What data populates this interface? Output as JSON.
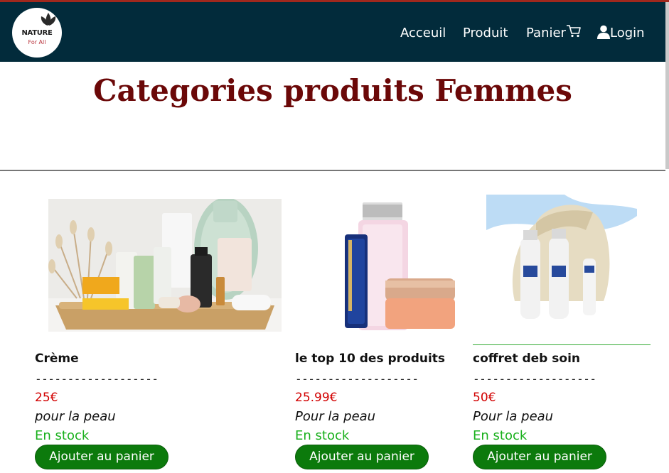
{
  "brand": {
    "logo_word": "NATURE",
    "logo_sub": "For All"
  },
  "nav": {
    "accueil": "Acceuil",
    "produit": "Produit",
    "panier": "Panier",
    "login": "Login"
  },
  "page": {
    "title": "Categories produits Femmes"
  },
  "colors": {
    "navbar": "#022b3b",
    "accent_bar": "#a0281d",
    "title": "#6b0808",
    "price": "#d20000",
    "stock": "#19b01c",
    "button": "#0c7a0c"
  },
  "products": [
    {
      "name": "Crème",
      "separator": "-------------------",
      "price": "25€",
      "description": "pour la peau",
      "stock": "En stock",
      "button": "Ajouter au panier",
      "image": "skincare-tray-photo"
    },
    {
      "name": "le top 10 des produits",
      "separator": "-------------------",
      "price": "25.99€",
      "description": "Pour la peau",
      "stock": "En stock",
      "button": "Ajouter au panier",
      "image": "lancome-clarins-products-photo"
    },
    {
      "name": "coffret deb soin",
      "separator": "-------------------",
      "price": "50€",
      "description": "Pour la peau",
      "stock": "En stock",
      "button": "Ajouter au panier",
      "image": "passion-marine-gift-set-photo"
    }
  ]
}
